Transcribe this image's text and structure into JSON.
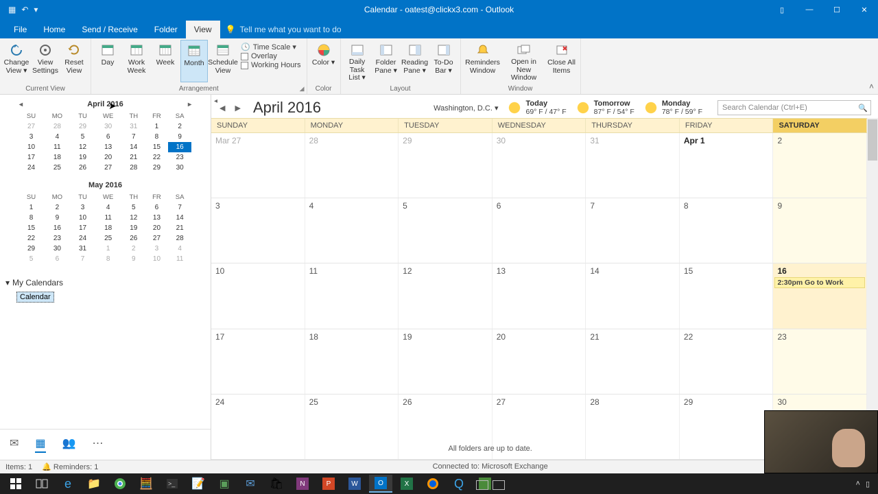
{
  "titlebar": {
    "title": "Calendar - oatest@clickx3.com - Outlook"
  },
  "tabs": {
    "file": "File",
    "home": "Home",
    "sendrecv": "Send / Receive",
    "folder": "Folder",
    "view": "View",
    "tellme": "Tell me what you want to do"
  },
  "ribbon": {
    "change_view": "Change\nView ▾",
    "view_settings": "View\nSettings",
    "reset_view": "Reset\nView",
    "day": "Day",
    "work_week": "Work\nWeek",
    "week": "Week",
    "month": "Month",
    "schedule": "Schedule\nView",
    "time_scale": "Time Scale ▾",
    "overlay": "Overlay",
    "working_hours": "Working Hours",
    "color": "Color\n▾",
    "daily_task": "Daily Task\nList ▾",
    "folder_pane": "Folder\nPane ▾",
    "reading_pane": "Reading\nPane ▾",
    "todo_bar": "To-Do\nBar ▾",
    "reminders": "Reminders\nWindow",
    "open_new": "Open in New\nWindow",
    "close_all": "Close\nAll Items",
    "g_current": "Current View",
    "g_arrangement": "Arrangement",
    "g_color": "Color",
    "g_layout": "Layout",
    "g_window": "Window"
  },
  "mini": {
    "dow": [
      "SU",
      "MO",
      "TU",
      "WE",
      "TH",
      "FR",
      "SA"
    ],
    "april": {
      "title": "April 2016",
      "rows": [
        [
          "27",
          "28",
          "29",
          "30",
          "31",
          "1",
          "2"
        ],
        [
          "3",
          "4",
          "5",
          "6",
          "7",
          "8",
          "9"
        ],
        [
          "10",
          "11",
          "12",
          "13",
          "14",
          "15",
          "16"
        ],
        [
          "17",
          "18",
          "19",
          "20",
          "21",
          "22",
          "23"
        ],
        [
          "24",
          "25",
          "26",
          "27",
          "28",
          "29",
          "30"
        ]
      ],
      "off": [
        [
          0,
          0
        ],
        [
          0,
          1
        ],
        [
          0,
          2
        ],
        [
          0,
          3
        ],
        [
          0,
          4
        ]
      ],
      "sel": [
        2,
        6
      ]
    },
    "may": {
      "title": "May 2016",
      "rows": [
        [
          "1",
          "2",
          "3",
          "4",
          "5",
          "6",
          "7"
        ],
        [
          "8",
          "9",
          "10",
          "11",
          "12",
          "13",
          "14"
        ],
        [
          "15",
          "16",
          "17",
          "18",
          "19",
          "20",
          "21"
        ],
        [
          "22",
          "23",
          "24",
          "25",
          "26",
          "27",
          "28"
        ],
        [
          "29",
          "30",
          "31",
          "1",
          "2",
          "3",
          "4"
        ],
        [
          "5",
          "6",
          "7",
          "8",
          "9",
          "10",
          "11"
        ]
      ],
      "off": [
        [
          4,
          3
        ],
        [
          4,
          4
        ],
        [
          4,
          5
        ],
        [
          4,
          6
        ],
        [
          5,
          0
        ],
        [
          5,
          1
        ],
        [
          5,
          2
        ],
        [
          5,
          3
        ],
        [
          5,
          4
        ],
        [
          5,
          5
        ],
        [
          5,
          6
        ]
      ]
    }
  },
  "mycal": {
    "header": "My Calendars",
    "item": "Calendar"
  },
  "header": {
    "month": "April 2016",
    "location": "Washington,  D.C.  ▾",
    "w": [
      {
        "label": "Today",
        "temp": "69° F / 47° F"
      },
      {
        "label": "Tomorrow",
        "temp": "87° F / 54° F"
      },
      {
        "label": "Monday",
        "temp": "78° F / 59° F"
      }
    ],
    "search_ph": "Search Calendar (Ctrl+E)"
  },
  "days": [
    "SUNDAY",
    "MONDAY",
    "TUESDAY",
    "WEDNESDAY",
    "THURSDAY",
    "FRIDAY",
    "SATURDAY"
  ],
  "weeks": [
    [
      "Mar 27",
      "28",
      "29",
      "30",
      "31",
      "Apr 1",
      "2"
    ],
    [
      "3",
      "4",
      "5",
      "6",
      "7",
      "8",
      "9"
    ],
    [
      "10",
      "11",
      "12",
      "13",
      "14",
      "15",
      "16"
    ],
    [
      "17",
      "18",
      "19",
      "20",
      "21",
      "22",
      "23"
    ],
    [
      "24",
      "25",
      "26",
      "27",
      "28",
      "29",
      "30"
    ]
  ],
  "event": "2:30pm Go to Work",
  "status": {
    "items": "Items: 1",
    "reminders": "Reminders: 1",
    "sync": "All folders are up to date.",
    "conn": "Connected to: Microsoft Exchange"
  }
}
